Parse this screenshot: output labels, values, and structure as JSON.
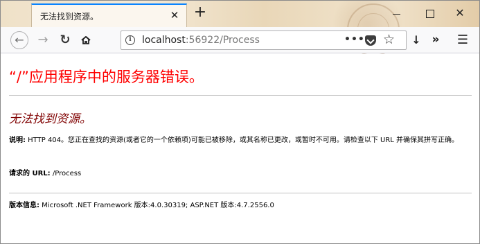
{
  "browser": {
    "tab_title": "无法找到资源。",
    "tab_close": "✕",
    "new_tab": "+",
    "window_close": "✕",
    "url_host": "localhost",
    "url_rest": ":56922/Process",
    "url_more": "•••",
    "star": "☆",
    "overflow": "»",
    "menu": "☰",
    "download": "↓"
  },
  "page": {
    "title": "“/”应用程序中的服务器错误。",
    "subtitle": "无法找到资源。",
    "description_label": "说明:",
    "description_text": " HTTP 404。您正在查找的资源(或者它的一个依赖项)可能已被移除，或其名称已更改，或暂时不可用。请检查以下 URL 并确保其拼写正确。",
    "requested_url_label": "请求的 URL:",
    "requested_url_value": " /Process",
    "version_label": "版本信息:",
    "version_text": " Microsoft .NET Framework 版本:4.0.30319; ASP.NET 版本:4.7.2556.0"
  },
  "colors": {
    "title_red": "#ff0000",
    "subtitle_maroon": "#800000",
    "tab_accent": "#0a84ff"
  }
}
